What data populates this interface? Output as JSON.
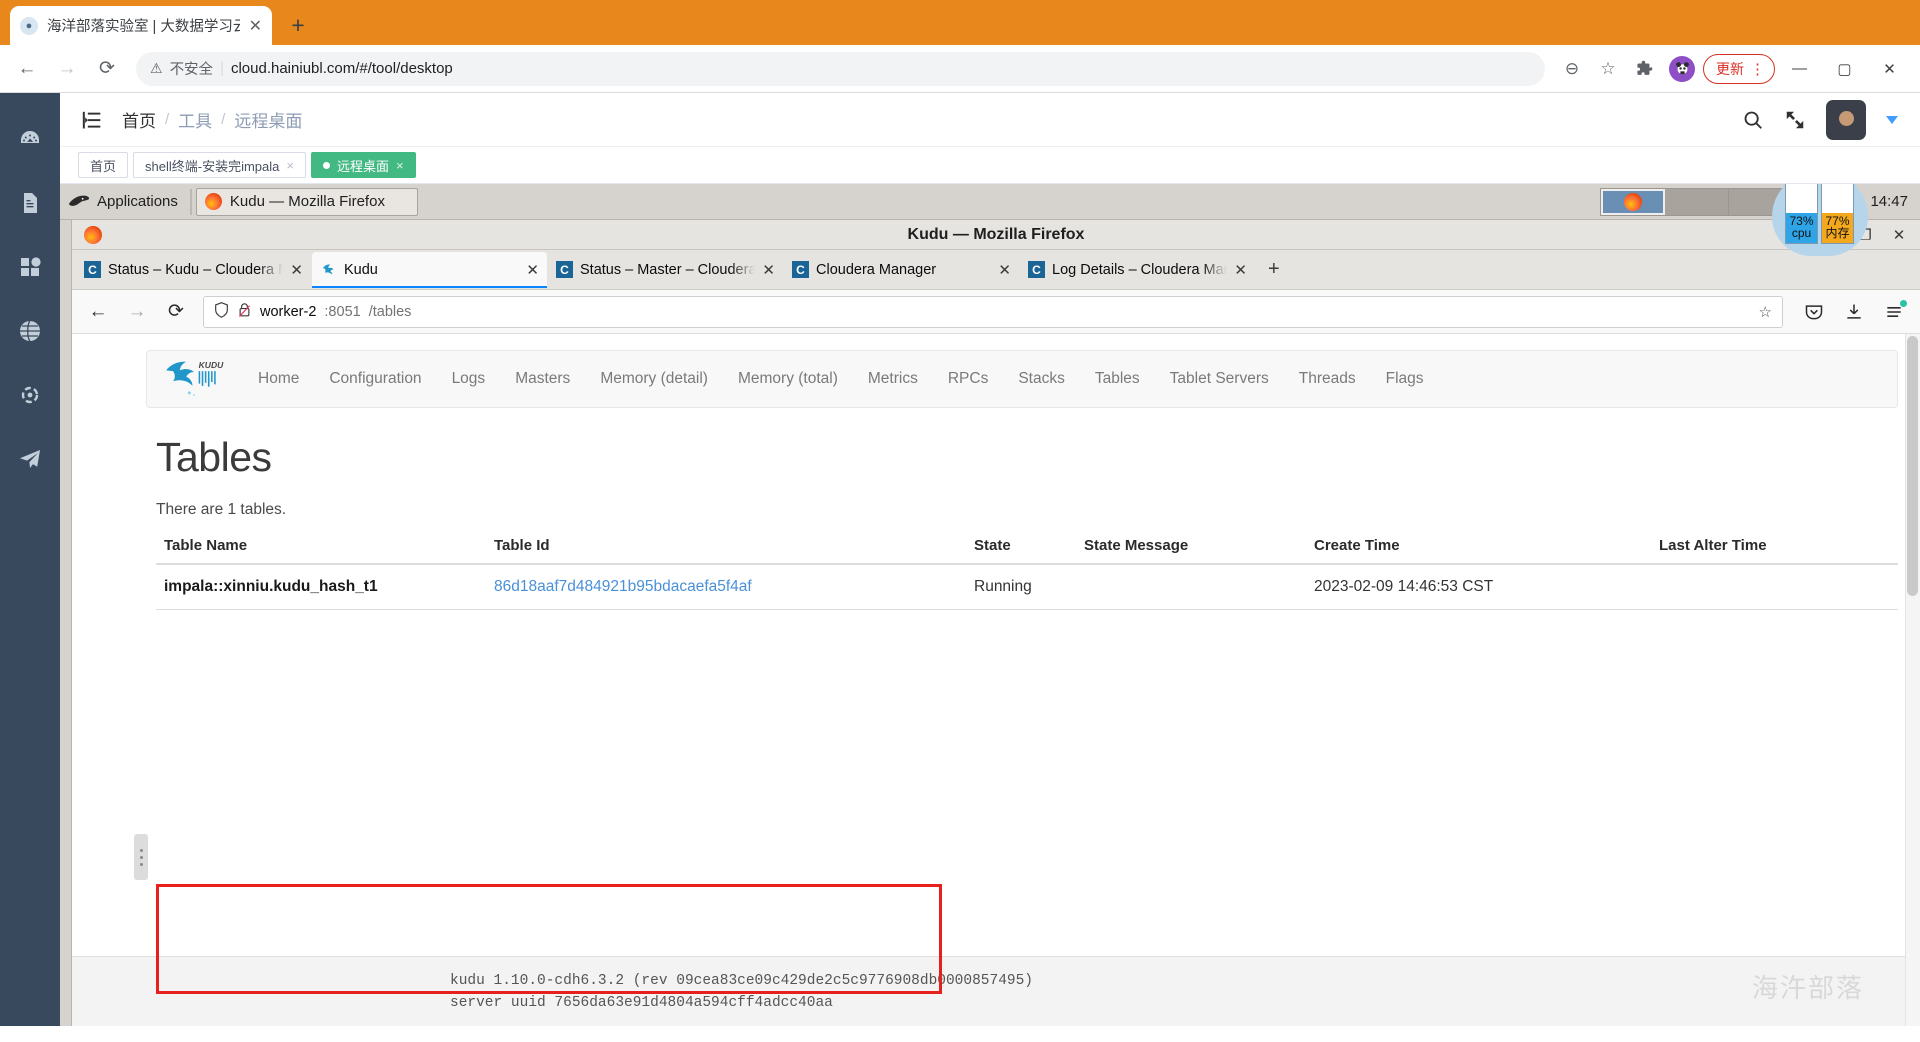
{
  "browser": {
    "tab": {
      "title": "海洋部落实验室 | 大数据学习云环",
      "favicon": "panda-icon",
      "close": "✕"
    },
    "new_tab": "+",
    "nav": {
      "back": "←",
      "forward": "→",
      "reload": "⟳"
    },
    "omnibox": {
      "warn_icon": "⚠",
      "insecure_label": "不安全",
      "separator": "|",
      "url": "cloud.hainiubl.com/#/tool/desktop"
    },
    "toolbar": {
      "zoom_out": "⊖",
      "bookmark": "☆",
      "extensions": "🧩",
      "profile": "🐼",
      "update_label": "更新",
      "menu_dots": "⋮"
    },
    "window_controls": {
      "minimize": "—",
      "maximize": "▢",
      "close": "✕"
    }
  },
  "app": {
    "sidebar": {
      "items": [
        {
          "icon": "gauge-icon",
          "name": "dashboard"
        },
        {
          "icon": "document-icon",
          "name": "documents"
        },
        {
          "icon": "grid-icon",
          "name": "apps"
        },
        {
          "icon": "globe-icon",
          "name": "network"
        },
        {
          "icon": "target-icon",
          "name": "monitor"
        },
        {
          "icon": "paper-plane-icon",
          "name": "deploy"
        }
      ]
    },
    "header": {
      "menu_icon": "collapse-menu-icon",
      "breadcrumb": [
        {
          "label": "首页",
          "current": true
        },
        {
          "label": "工具",
          "current": false
        },
        {
          "label": "远程桌面",
          "current": false
        }
      ],
      "separator": "/",
      "search_icon": "search-icon",
      "fullscreen_icon": "fullscreen-icon",
      "avatar": "user-avatar",
      "caret": "▾"
    },
    "tabs": [
      {
        "label": "首页",
        "closable": false,
        "active": false
      },
      {
        "label": "shell终端-安装完impala",
        "closable": true,
        "active": false
      },
      {
        "label": "远程桌面",
        "closable": true,
        "active": true
      }
    ],
    "tab_close": "×"
  },
  "desktop": {
    "panel": {
      "applications_label": "Applications",
      "applications_icon": "mouse-icon",
      "window_button": "Kudu — Mozilla Firefox",
      "workspace_count": 4,
      "active_workspace": 1,
      "clock": "14:47",
      "cpu": {
        "value": "73%",
        "label": "cpu",
        "color": "#2fa4e7"
      },
      "memory": {
        "value": "77%",
        "label": "内存",
        "color": "#f4a81d"
      }
    }
  },
  "firefox": {
    "window_title": "Kudu — Mozilla Firefox",
    "window_controls": {
      "restore": "❐",
      "close": "✕"
    },
    "tabs": [
      {
        "title": "Status – Kudu – Cloudera M",
        "icon": "cloudera-icon",
        "active": false
      },
      {
        "title": "Kudu",
        "icon": "kudu-icon",
        "active": true
      },
      {
        "title": "Status – Master – Cloudera",
        "icon": "cloudera-icon",
        "active": false
      },
      {
        "title": "Cloudera Manager",
        "icon": "cloudera-icon",
        "active": false
      },
      {
        "title": "Log Details – Cloudera Mana",
        "icon": "cloudera-icon",
        "active": false
      }
    ],
    "tab_close": "✕",
    "new_tab": "+",
    "nav": {
      "back": "←",
      "forward": "→",
      "reload": "⟳"
    },
    "url": {
      "host": "worker-2",
      "port": ":8051",
      "path": "/tables",
      "shield_icon": "shield-icon",
      "lock_broken_icon": "lock-broken-icon",
      "star_icon": "☆"
    },
    "toolbar_right": {
      "pocket": "pocket-icon",
      "downloads": "download-icon",
      "menu": "hamburger-icon"
    }
  },
  "kudu": {
    "logo": "kudu-logo",
    "nav_links": [
      "Home",
      "Configuration",
      "Logs",
      "Masters",
      "Memory (detail)",
      "Memory (total)",
      "Metrics",
      "RPCs",
      "Stacks",
      "Tables",
      "Tablet Servers",
      "Threads",
      "Flags"
    ],
    "page_title": "Tables",
    "count_text": "There are 1 tables.",
    "table": {
      "columns": [
        "Table Name",
        "Table Id",
        "State",
        "State Message",
        "Create Time",
        "Last Alter Time"
      ],
      "rows": [
        {
          "table_name": "impala::xinniu.kudu_hash_t1",
          "table_id": "86d18aaf7d484921b95bdacaefa5f4af",
          "state": "Running",
          "state_message": "",
          "create_time": "2023-02-09 14:46:53 CST",
          "last_alter_time": ""
        }
      ]
    },
    "footer": {
      "line1": "kudu 1.10.0-cdh6.3.2 (rev 09cea83ce09c429de2c5c9776908db0000857495)",
      "line2": "server uuid 7656da63e91d4804a594cff4adcc40aa"
    },
    "watermark": "海汻部落",
    "highlight_color": "#e8201d"
  }
}
